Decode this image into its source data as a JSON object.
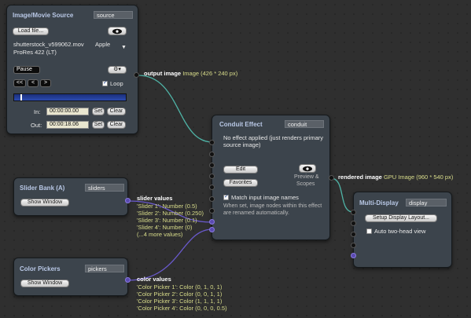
{
  "colors": {
    "canvas": "#2f2f2f",
    "node": "#3c444c",
    "title": "#b9c8e6",
    "value": "#d8dc8a",
    "wire_image": "#4fb3a6",
    "wire_values": "#6a5acd"
  },
  "image_source": {
    "title": "Image/Movie Source",
    "identifier": "source",
    "load_label": "Load file...",
    "eye_icon": "eye-icon",
    "filename": "shutterstock_v599062.mov",
    "codec_a": "Apple",
    "codec_b": "ProRes 422 (LT)",
    "pause_label": "Pause",
    "gear_icon": "gear-icon",
    "rewind_label": "<<",
    "prev_label": "<",
    "next_label": ">",
    "loop_label": "Loop",
    "loop_checked": true,
    "in_label": "In:",
    "in_value": "00:00:00.00",
    "out_label": "Out:",
    "out_value": "00:00:18.06",
    "set_label": "Set",
    "clear_label": "Clear",
    "output_label": "output image",
    "output_value": "Image (426 * 240 px)"
  },
  "conduit": {
    "title": "Conduit Effect",
    "identifier": "conduit",
    "description": "No effect applied (just renders primary source image)",
    "edit_label": "Edit",
    "favorites_label": "Favorites",
    "preview_label": "Preview &",
    "scopes_label": "Scopes",
    "match_label": "Match input image names",
    "match_checked": true,
    "match_help": "When set, image nodes within this effect are renamed automatically.",
    "output_label": "rendered image",
    "output_value": "GPU Image (960 * 540 px)"
  },
  "slider_bank": {
    "title": "Slider Bank (A)",
    "identifier": "sliders",
    "show_label": "Show Window",
    "output_label": "slider values",
    "values": [
      "'Slider 1': Number (0.5)",
      "'Slider 2': Number (0.250)",
      "'Slider 3': Number (0.1)",
      "'Slider 4': Number (0)",
      "(...4 more values)"
    ]
  },
  "color_pickers": {
    "title": "Color Pickers",
    "identifier": "pickers",
    "show_label": "Show Window",
    "output_label": "color values",
    "values": [
      "'Color Picker 1': Color (0, 1, 0, 1)",
      "'Color Picker 2': Color (0, 0, 1, 1)",
      "'Color Picker 3': Color (1, 1, 1, 1)",
      "'Color Picker 4': Color (0, 0, 0, 0.5)"
    ]
  },
  "multi_display": {
    "title": "Multi-Display",
    "identifier": "display",
    "setup_label": "Setup Display Layout...",
    "two_head_label": "Auto two-head view",
    "two_head_checked": false
  }
}
